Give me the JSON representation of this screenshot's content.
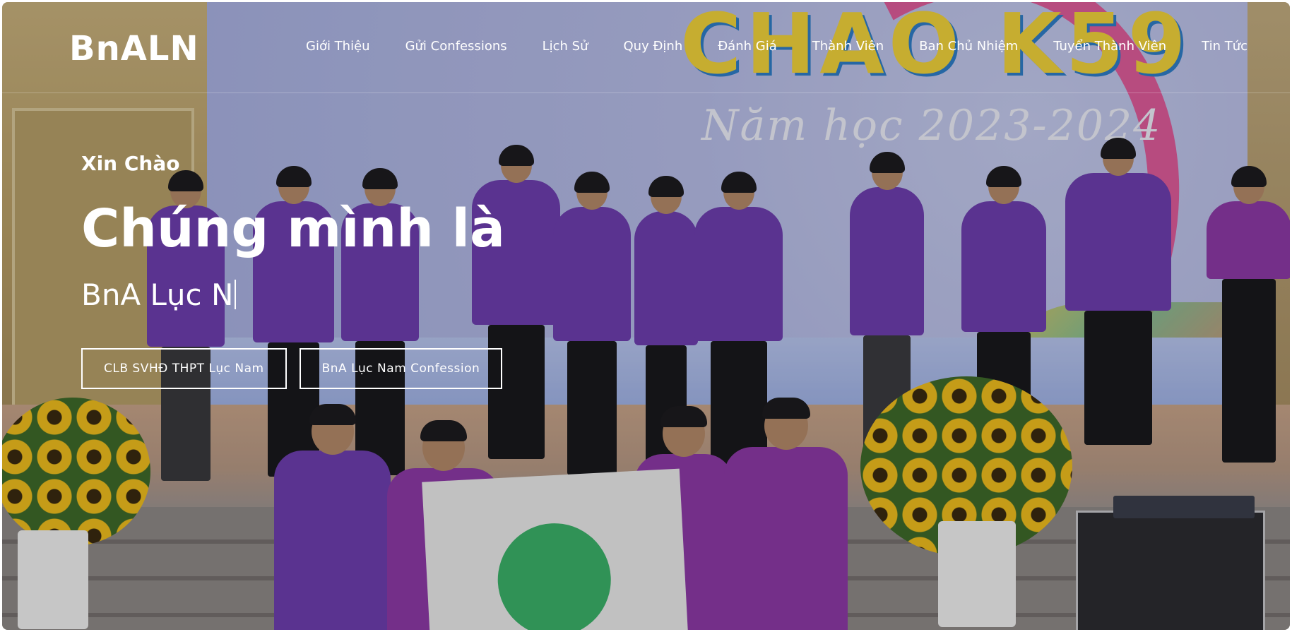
{
  "brand": {
    "name": "BnALN"
  },
  "nav": {
    "items": [
      {
        "label": "Giới Thiệu"
      },
      {
        "label": "Gửi Confessions"
      },
      {
        "label": "Lịch Sử"
      },
      {
        "label": "Quy Định"
      },
      {
        "label": "Đánh Giá"
      },
      {
        "label": "Thành Viên"
      },
      {
        "label": "Ban Chủ Nhiệm"
      },
      {
        "label": "Tuyển Thành Viên"
      },
      {
        "label": "Tin Tức"
      }
    ]
  },
  "hero": {
    "greeting": "Xin Chào",
    "headline": "Chúng mình là",
    "typed_text": "BnA Lục N",
    "buttons": [
      {
        "label": "CLB SVHĐ THPT Lục Nam"
      },
      {
        "label": "BnA Lục Nam Confession"
      }
    ],
    "background_photo": {
      "banner_title": "CHAO K59",
      "banner_subtitle": "Năm học 2023-2024"
    }
  },
  "colors": {
    "text": "#ffffff",
    "shirt_purple": "#6e3fb0",
    "shirt_magenta": "#8e3aa8",
    "sunflower": "#f1bf1e"
  }
}
